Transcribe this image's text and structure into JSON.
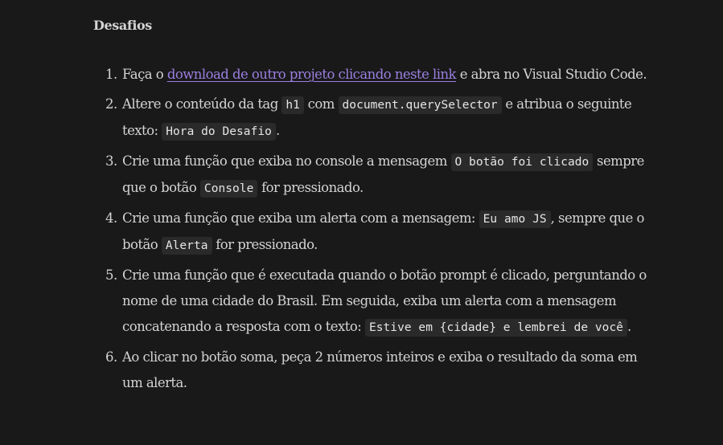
{
  "title": "Desafios",
  "items": [
    {
      "number": "1.",
      "parts": [
        {
          "t": "text",
          "v": "Faça o "
        },
        {
          "t": "link",
          "v": "download de outro projeto clicando neste link"
        },
        {
          "t": "text",
          "v": " e abra no Visual Studio Code."
        }
      ]
    },
    {
      "number": "2.",
      "parts": [
        {
          "t": "text",
          "v": "Altere o conteúdo da tag "
        },
        {
          "t": "code",
          "v": "h1"
        },
        {
          "t": "text",
          "v": " com "
        },
        {
          "t": "code",
          "v": "document.querySelector"
        },
        {
          "t": "text",
          "v": " e atribua o seguinte texto: "
        },
        {
          "t": "code",
          "v": "Hora do Desafio"
        },
        {
          "t": "text",
          "v": "."
        }
      ]
    },
    {
      "number": "3.",
      "parts": [
        {
          "t": "text",
          "v": "Crie uma função que exiba no console a mensagem "
        },
        {
          "t": "code",
          "v": "O botão foi clicado"
        },
        {
          "t": "text",
          "v": " sempre que o botão "
        },
        {
          "t": "code",
          "v": "Console"
        },
        {
          "t": "text",
          "v": " for pressionado."
        }
      ]
    },
    {
      "number": "4.",
      "parts": [
        {
          "t": "text",
          "v": "Crie uma função que exiba um alerta com a mensagem: "
        },
        {
          "t": "code",
          "v": "Eu amo JS"
        },
        {
          "t": "text",
          "v": ", sempre que o botão "
        },
        {
          "t": "code",
          "v": "Alerta"
        },
        {
          "t": "text",
          "v": " for pressionado."
        }
      ]
    },
    {
      "number": "5.",
      "parts": [
        {
          "t": "text",
          "v": "Crie uma função que é executada quando o botão prompt é clicado, perguntando o nome de uma cidade do Brasil. Em seguida, exiba um alerta com a mensagem concatenando a resposta com o texto: "
        },
        {
          "t": "code",
          "v": "Estive em {cidade} e lembrei de você"
        },
        {
          "t": "text",
          "v": "."
        }
      ]
    },
    {
      "number": "6.",
      "parts": [
        {
          "t": "text",
          "v": "Ao clicar no botão soma, peça 2 números inteiros e exiba o resultado da soma em um alerta."
        }
      ]
    }
  ]
}
